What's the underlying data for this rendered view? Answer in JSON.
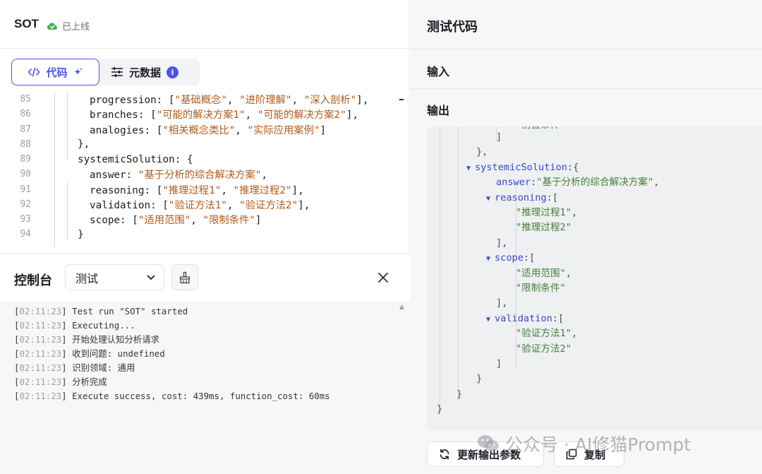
{
  "app": {
    "name": "SOT",
    "status": "已上线",
    "status_color": "#3fb34f"
  },
  "tabs": [
    {
      "label": "代码",
      "active": true
    },
    {
      "label": "元数据",
      "active": false
    }
  ],
  "editor": {
    "lines": [
      {
        "n": "85",
        "indent": 2,
        "key": "progression",
        "values": [
          "基础概念",
          "进阶理解",
          "深入剖析"
        ],
        "tail": "],"
      },
      {
        "n": "86",
        "indent": 2,
        "key": "branches",
        "values": [
          "可能的解决方案1",
          "可能的解决方案2"
        ],
        "tail": "],"
      },
      {
        "n": "87",
        "indent": 2,
        "key": "analogies",
        "values": [
          "相关概念类比",
          "实际应用案例"
        ],
        "tail": "]"
      },
      {
        "n": "88",
        "indent": 1,
        "raw": "},"
      },
      {
        "n": "89",
        "indent": 1,
        "raw": "systemicSolution: {"
      },
      {
        "n": "90",
        "indent": 2,
        "key": "answer",
        "string": "基于分析的综合解决方案",
        "tail": ","
      },
      {
        "n": "91",
        "indent": 2,
        "key": "reasoning",
        "values": [
          "推理过程1",
          "推理过程2"
        ],
        "tail": "],"
      },
      {
        "n": "92",
        "indent": 2,
        "key": "validation",
        "values": [
          "验证方法1",
          "验证方法2"
        ],
        "tail": "],"
      },
      {
        "n": "93",
        "indent": 2,
        "key": "scope",
        "values": [
          "适用范围",
          "限制条件"
        ],
        "tail": "]"
      },
      {
        "n": "94",
        "indent": 1,
        "raw": "}"
      }
    ]
  },
  "console": {
    "title": "控制台",
    "selected": "测试",
    "logs": [
      {
        "time": "02:11:23",
        "msg": "Test run \"SOT\" started"
      },
      {
        "time": "02:11:23",
        "msg": "Executing..."
      },
      {
        "time": "02:11:23",
        "msg": "开始处理认知分析请求"
      },
      {
        "time": "02:11:23",
        "msg": "收到问题: undefined"
      },
      {
        "time": "02:11:23",
        "msg": "识别领域: 通用"
      },
      {
        "time": "02:11:23",
        "msg": "分析完成"
      },
      {
        "time": "02:11:23",
        "msg": "Execute success, cost: 439ms, function_cost: 60ms"
      }
    ]
  },
  "test_panel": {
    "title": "测试代码",
    "input_label": "输入",
    "output_label": "输出",
    "partial_top": "前置条件",
    "output_lines": [
      {
        "indent": 4,
        "text": "]"
      },
      {
        "indent": 3,
        "text": "},"
      },
      {
        "indent": 3,
        "key": "systemicSolution",
        "open": "{",
        "collapsible": true
      },
      {
        "indent": 4,
        "key": "answer",
        "string": "基于分析的综合解决方案",
        "tail": ","
      },
      {
        "indent": 4,
        "key": "reasoning",
        "open": "[",
        "collapsible": true
      },
      {
        "indent": 5,
        "string": "推理过程1",
        "tail": ","
      },
      {
        "indent": 5,
        "string": "推理过程2"
      },
      {
        "indent": 4,
        "text": "],"
      },
      {
        "indent": 4,
        "key": "scope",
        "open": "[",
        "collapsible": true
      },
      {
        "indent": 5,
        "string": "适用范围",
        "tail": ","
      },
      {
        "indent": 5,
        "string": "限制条件"
      },
      {
        "indent": 4,
        "text": "],"
      },
      {
        "indent": 4,
        "key": "validation",
        "open": "[",
        "collapsible": true
      },
      {
        "indent": 5,
        "string": "验证方法1",
        "tail": ","
      },
      {
        "indent": 5,
        "string": "验证方法2"
      },
      {
        "indent": 4,
        "text": "]"
      },
      {
        "indent": 3,
        "text": "}"
      },
      {
        "indent": 2,
        "text": "}"
      },
      {
        "indent": 0,
        "text": "}"
      }
    ],
    "refresh_label": "更新输出参数",
    "copy_label": "复制"
  },
  "watermark": "公众号 · AI修猫Prompt",
  "colors": {
    "accent": "#4d53e8",
    "string": "#b05a1a",
    "json_key": "#3a46c8",
    "json_string": "#46803a"
  }
}
